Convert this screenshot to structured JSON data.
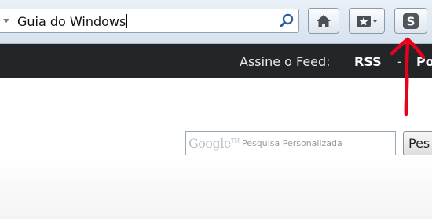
{
  "browser": {
    "search_value": "Guia do Windows",
    "buttons": {
      "home": "home-icon",
      "bookmarks": "bookmark-star-icon",
      "addon": "s-addon-icon"
    }
  },
  "site_header": {
    "feed_label": "Assine o Feed:",
    "rss_link": "RSS",
    "separator": "-",
    "next_link": "Po"
  },
  "google_search": {
    "logo": "Google",
    "trademark": "TM",
    "placeholder": "Pesquisa Personalizada",
    "button_label": "Pes"
  },
  "colors": {
    "header_bg": "#222628",
    "annotation": "#e8001c"
  }
}
